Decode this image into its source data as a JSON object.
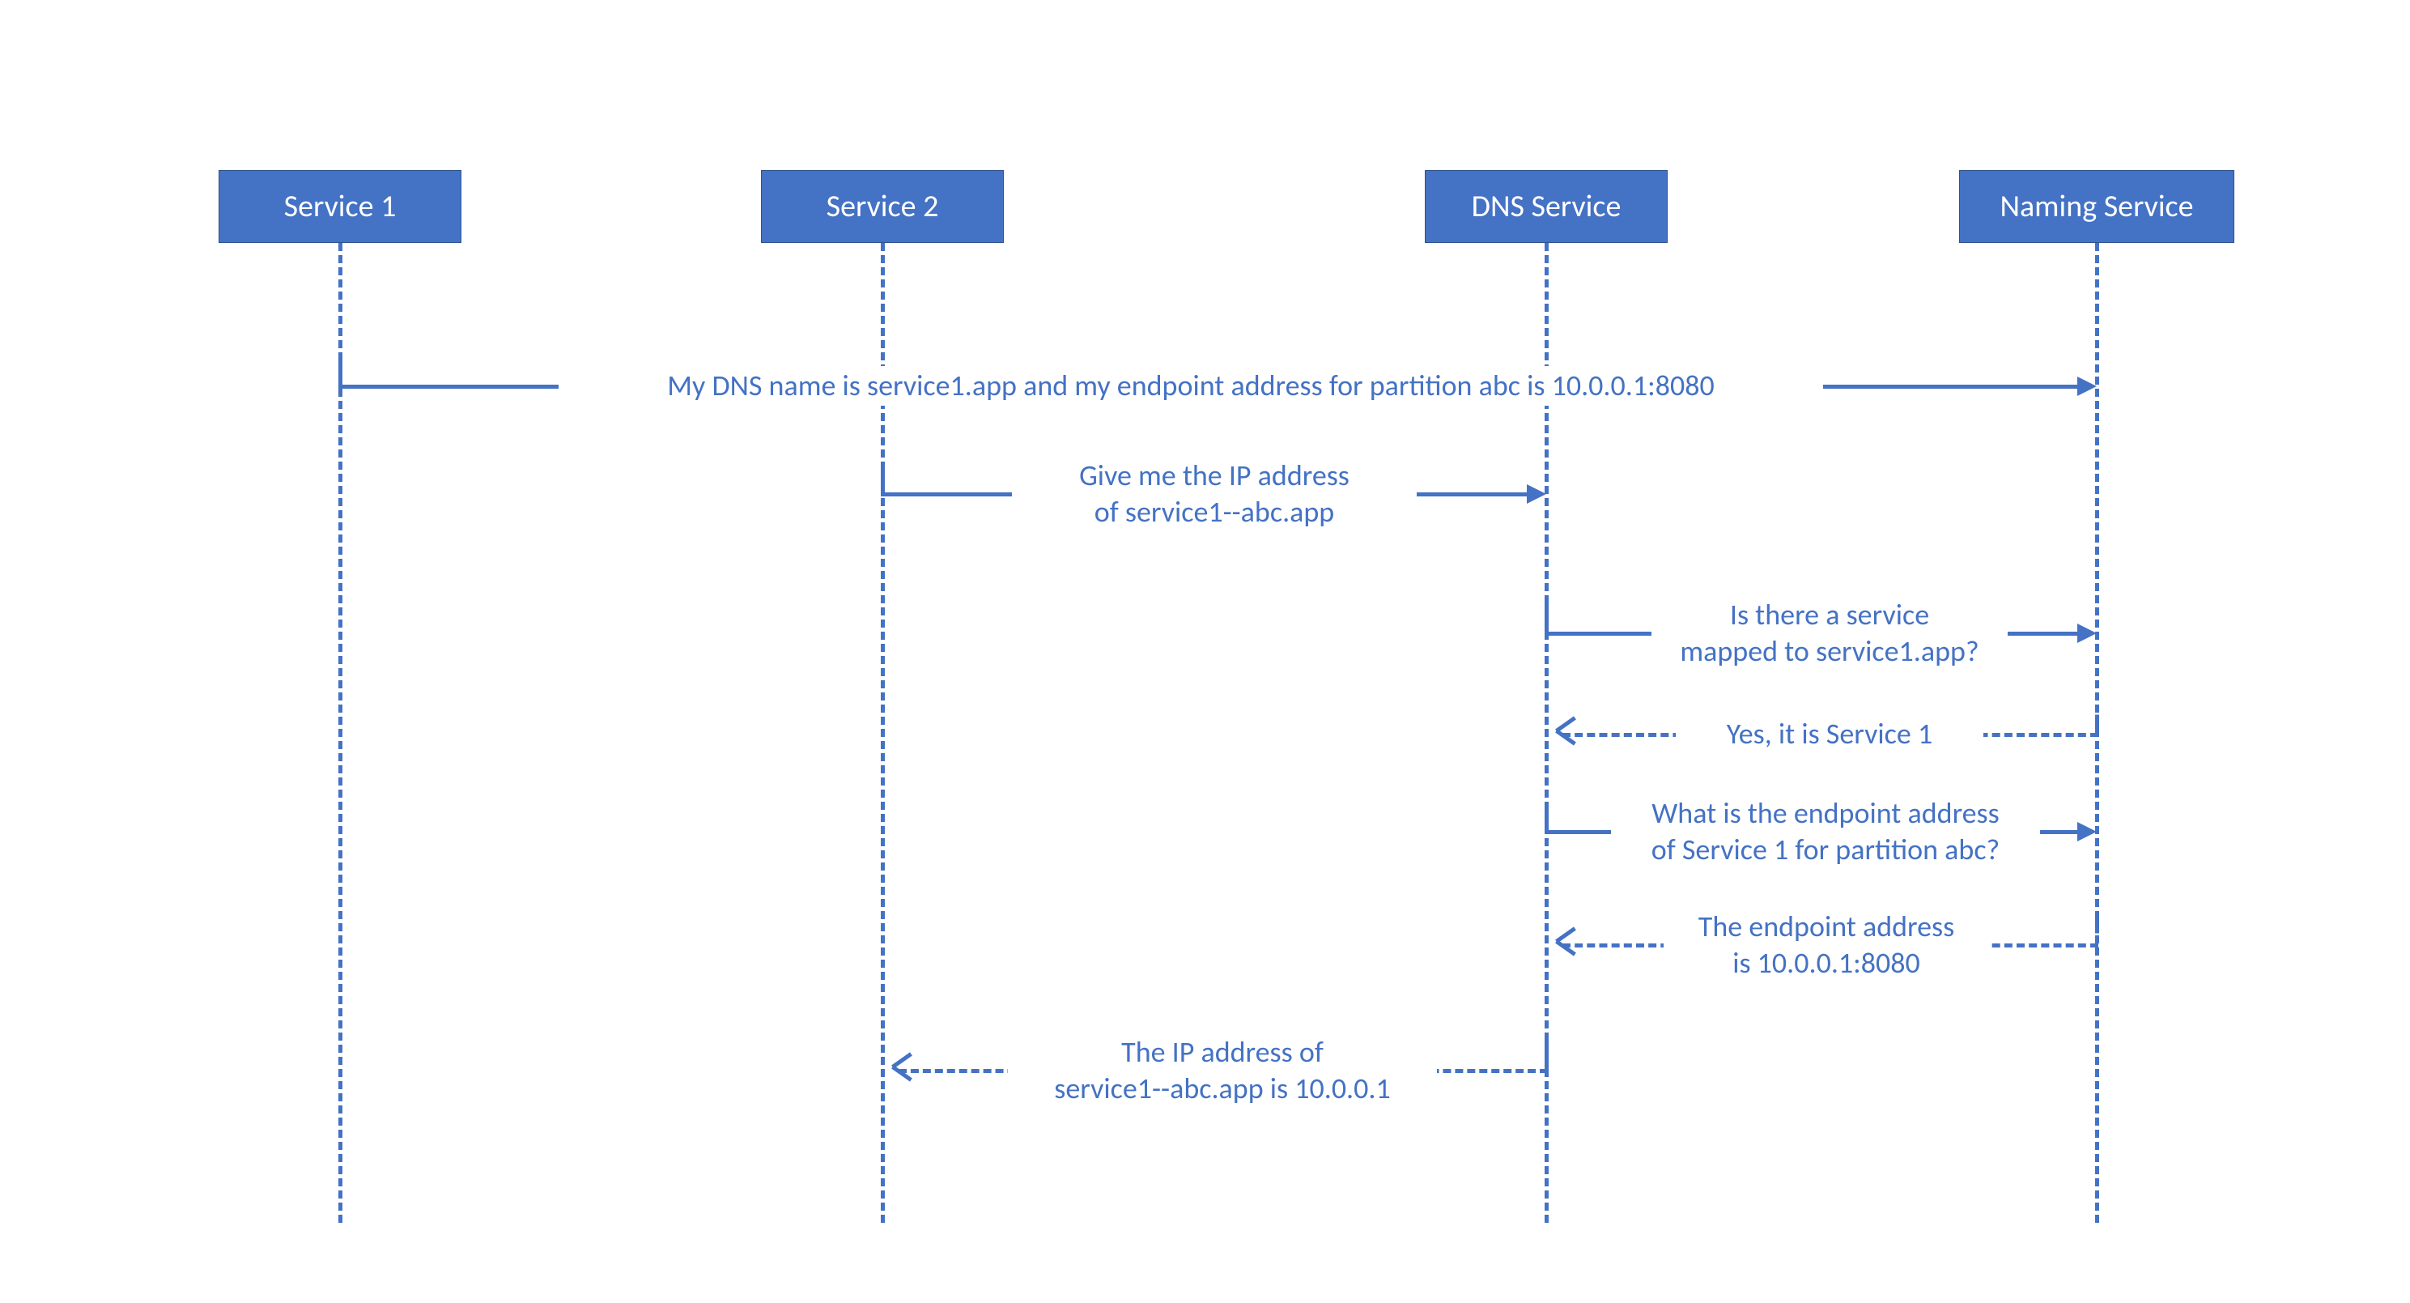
{
  "participants": {
    "p1": "Service 1",
    "p2": "Service 2",
    "p3": "DNS Service",
    "p4": "Naming Service"
  },
  "messages": {
    "m1": "My DNS name is service1.app and my endpoint address for partition abc is 10.0.0.1:8080",
    "m2a": "Give me the IP address",
    "m2b": "of service1--abc.app",
    "m3a": "Is there a service",
    "m3b": "mapped to service1.app?",
    "m4": "Yes, it is Service 1",
    "m5a": "What is the endpoint address",
    "m5b": "of Service 1 for partition abc?",
    "m6a": "The endpoint address",
    "m6b": "is 10.0.0.1:8080",
    "m7a": "The IP address of",
    "m7b": "service1--abc.app is 10.0.0.1"
  },
  "colors": {
    "primary": "#4472c4"
  }
}
